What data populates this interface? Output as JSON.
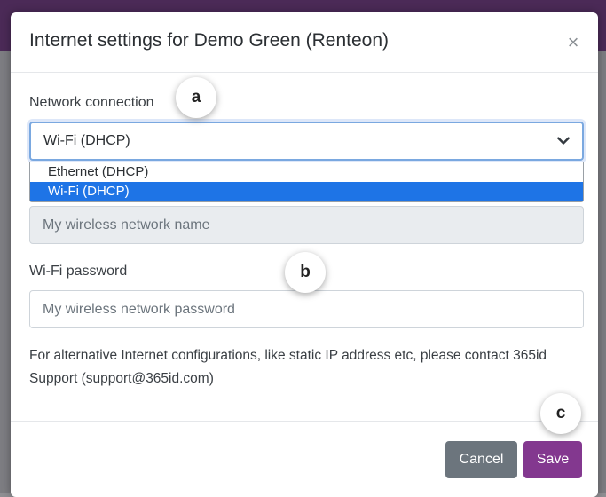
{
  "modal": {
    "title": "Internet settings for Demo Green (Renteon)",
    "close_glyph": "×"
  },
  "network": {
    "label": "Network connection",
    "selected": "Wi-Fi (DHCP)",
    "options": [
      "Ethernet (DHCP)",
      "Wi-Fi (DHCP)"
    ]
  },
  "wifi_name": {
    "placeholder": "My wireless network name"
  },
  "wifi_password": {
    "label": "Wi-Fi password",
    "placeholder": "My wireless network password"
  },
  "help_text": "For alternative Internet configurations, like static IP address etc, please contact 365id Support (support@365id.com)",
  "footer": {
    "cancel_label": "Cancel",
    "save_label": "Save"
  },
  "callouts": {
    "a": "a",
    "b": "b",
    "c": "c"
  },
  "colors": {
    "save_accent": "#83388f",
    "cancel": "#6c757d",
    "selected_option": "#1e74e6"
  }
}
